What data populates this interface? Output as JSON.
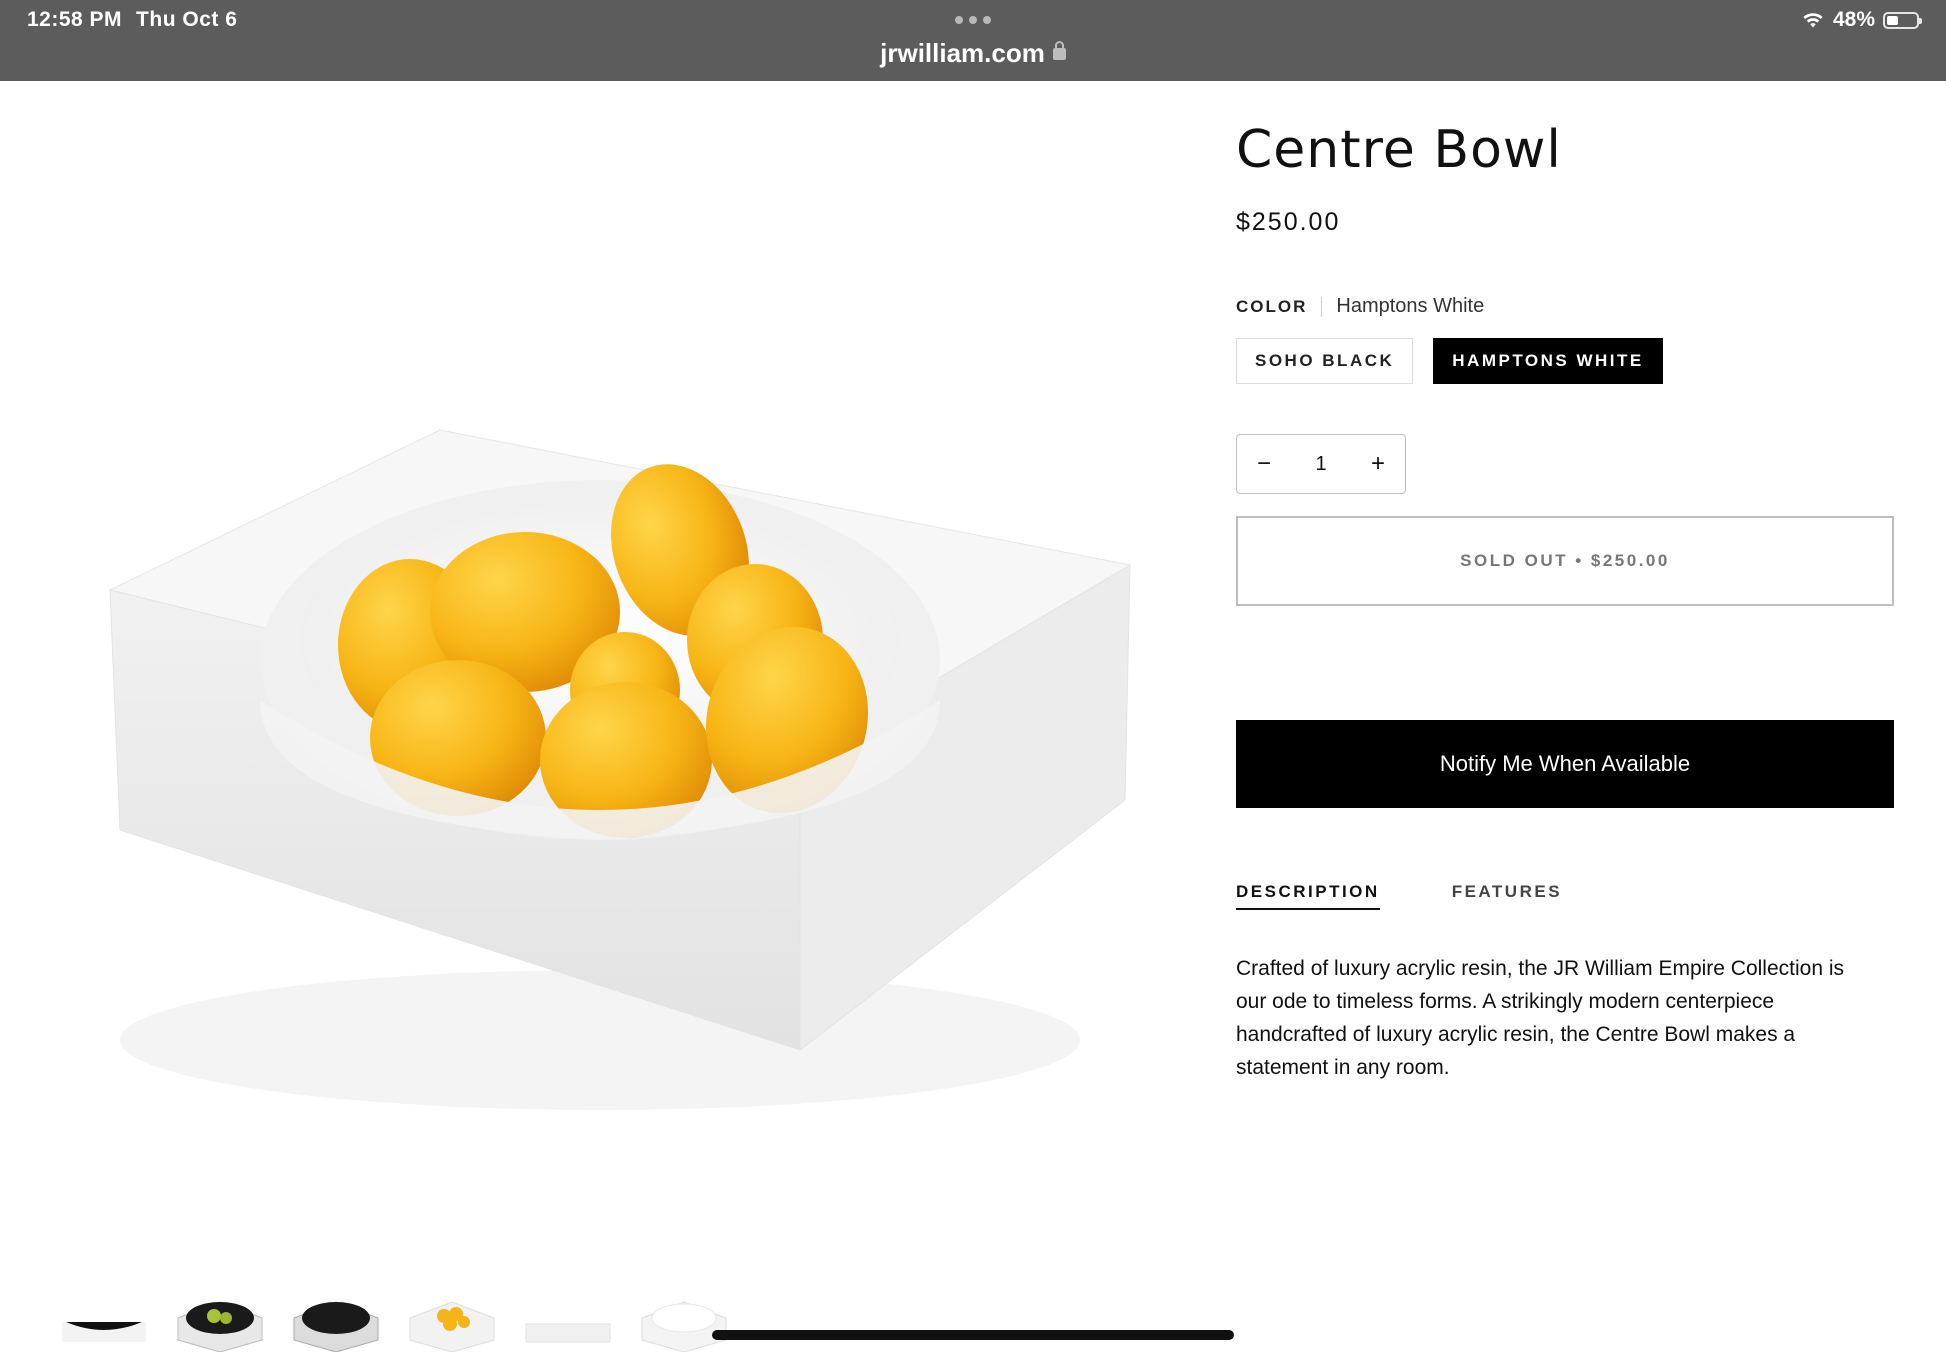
{
  "status": {
    "time": "12:58 PM",
    "date": "Thu Oct 6",
    "battery": "48%",
    "battery_level": 0.48
  },
  "browser": {
    "url": "jrwilliam.com"
  },
  "product": {
    "title": "Centre Bowl",
    "price": "$250.00",
    "color_label": "COLOR",
    "color_value": "Hamptons White",
    "swatches": [
      {
        "label": "SOHO BLACK",
        "selected": false
      },
      {
        "label": "HAMPTONS WHITE",
        "selected": true
      }
    ],
    "quantity": "1",
    "qty_minus": "−",
    "qty_plus": "+",
    "soldout_label": "SOLD OUT • $250.00",
    "notify_label": "Notify Me When Available",
    "tabs": [
      {
        "label": "DESCRIPTION",
        "active": true
      },
      {
        "label": "FEATURES",
        "active": false
      }
    ],
    "description": "Crafted of luxury acrylic resin, the JR William Empire Collection is our ode to timeless forms. A strikingly modern centerpiece handcrafted of luxury acrylic resin, the Centre Bowl makes a statement in any room."
  },
  "colors": {
    "topbar": "#5c5c5c",
    "accent": "#000000",
    "lemon": "#f5b417"
  },
  "icons": {
    "wifi": "wifi-icon",
    "battery": "battery-icon",
    "lock": "lock-icon",
    "more": "more-dots-icon"
  }
}
